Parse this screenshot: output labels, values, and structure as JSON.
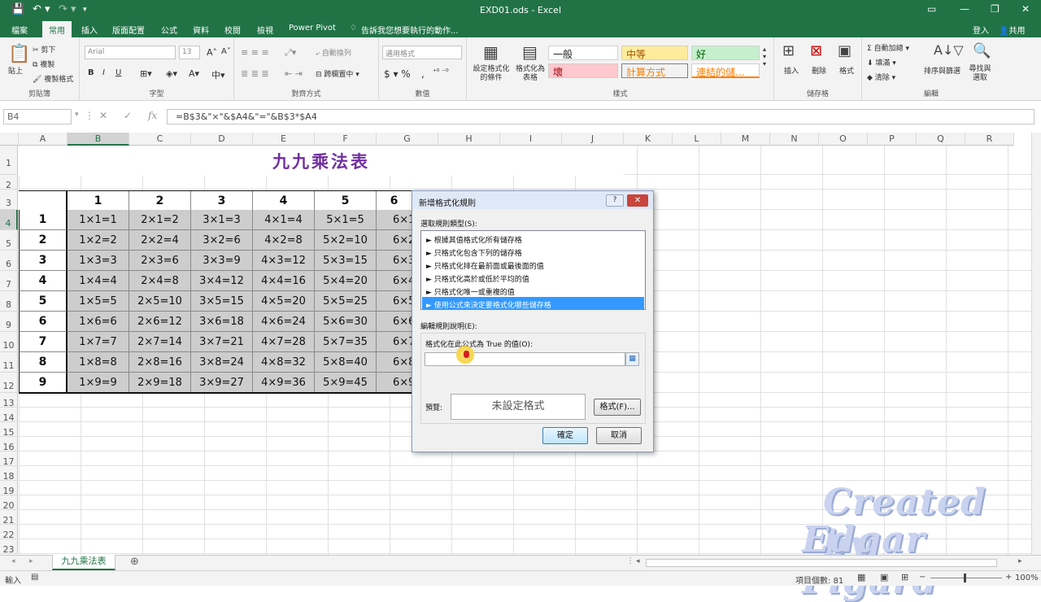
{
  "window": {
    "title": "EXD01.ods - Excel",
    "quick_access": [
      "💾",
      "↶ ▾",
      "↷ ▾",
      "▾"
    ]
  },
  "account": {
    "signin": "登入",
    "share": "共用"
  },
  "tabs": [
    "檔案",
    "常用",
    "插入",
    "版面配置",
    "公式",
    "資料",
    "校閱",
    "檢視",
    "Power Pivot"
  ],
  "tellme": "告訴我您想要執行的動作...",
  "ribbon": {
    "clipboard": {
      "label": "剪貼簿",
      "paste": "貼上",
      "cut": "剪下",
      "copy": "複製",
      "format_painter": "複製格式"
    },
    "font": {
      "label": "字型",
      "font_name": "Arial",
      "font_size": "13",
      "bold": "B",
      "italic": "I",
      "underline": "U"
    },
    "alignment": {
      "label": "對齊方式",
      "wrap": "自動換列",
      "merge": "跨欄置中"
    },
    "number": {
      "label": "數值",
      "format": "通用格式"
    },
    "styles": {
      "label": "樣式",
      "conditional": "設定格式化的條件",
      "table": "格式化為表格",
      "normal": "一般",
      "neutral": "中等",
      "good": "好",
      "bad": "壞",
      "calc": "計算方式",
      "link": "連結的儲..."
    },
    "cells": {
      "label": "儲存格",
      "insert": "插入",
      "delete": "刪除",
      "format": "格式"
    },
    "editing": {
      "label": "編輯",
      "autosum": "自動加總",
      "fill": "填滿",
      "clear": "清除",
      "sort": "排序與篩選",
      "find": "尋找與選取"
    }
  },
  "formula_bar": {
    "cell": "B4",
    "formula": "=B$3&\"×\"&$A4&\"=\"&B$3*$A4",
    "fx": "fx"
  },
  "columns": [
    "A",
    "B",
    "C",
    "D",
    "E",
    "F",
    "G",
    "H",
    "I",
    "J",
    "K",
    "L",
    "M",
    "N",
    "O",
    "P",
    "Q",
    "R"
  ],
  "rows": [
    "1",
    "2",
    "3",
    "4",
    "5",
    "6",
    "7",
    "8",
    "9",
    "10",
    "11",
    "12",
    "13",
    "14",
    "15",
    "16",
    "17",
    "18",
    "19",
    "20",
    "21",
    "22",
    "23"
  ],
  "sheet_title": "九九乘法表",
  "header_row": [
    "1",
    "2",
    "3",
    "4",
    "5",
    "6"
  ],
  "table": [
    {
      "n": "1",
      "cells": [
        "1×1=1",
        "2×1=2",
        "3×1=3",
        "4×1=4",
        "5×1=5",
        "6×1"
      ]
    },
    {
      "n": "2",
      "cells": [
        "1×2=2",
        "2×2=4",
        "3×2=6",
        "4×2=8",
        "5×2=10",
        "6×2="
      ]
    },
    {
      "n": "3",
      "cells": [
        "1×3=3",
        "2×3=6",
        "3×3=9",
        "4×3=12",
        "5×3=15",
        "6×3="
      ]
    },
    {
      "n": "4",
      "cells": [
        "1×4=4",
        "2×4=8",
        "3×4=12",
        "4×4=16",
        "5×4=20",
        "6×4="
      ]
    },
    {
      "n": "5",
      "cells": [
        "1×5=5",
        "2×5=10",
        "3×5=15",
        "4×5=20",
        "5×5=25",
        "6×5="
      ]
    },
    {
      "n": "6",
      "cells": [
        "1×6=6",
        "2×6=12",
        "3×6=18",
        "4×6=24",
        "5×6=30",
        "6×6="
      ]
    },
    {
      "n": "7",
      "cells": [
        "1×7=7",
        "2×7=14",
        "3×7=21",
        "4×7=28",
        "5×7=35",
        "6×7="
      ]
    },
    {
      "n": "8",
      "cells": [
        "1×8=8",
        "2×8=16",
        "3×8=24",
        "4×8=32",
        "5×8=40",
        "6×8="
      ]
    },
    {
      "n": "9",
      "cells": [
        "1×9=9",
        "2×9=18",
        "3×9=27",
        "4×9=36",
        "5×9=45",
        "6×9="
      ]
    }
  ],
  "dialog": {
    "title": "新增格式化規則",
    "help": "?",
    "close": "✕",
    "select_type": "選取規則類型(S):",
    "rule_types": [
      "► 根據其值格式化所有儲存格",
      "► 只格式化包含下列的儲存格",
      "► 只格式化排在最前面或最後面的值",
      "► 只格式化高於或低於平均的值",
      "► 只格式化唯一或重複的值",
      "► 使用公式來決定要格式化哪些儲存格"
    ],
    "edit_desc": "編輯規則說明(E):",
    "formula_label": "格式化在此公式為 True 的值(O):",
    "formula_value": "",
    "preview_label": "預覽:",
    "preview_text": "未設定格式",
    "format_btn": "格式(F)...",
    "ok": "確定",
    "cancel": "取消"
  },
  "sheet_tab": "九九乘法表",
  "status": {
    "mode": "輸入",
    "count": "項目個數: 81",
    "zoom": "100%"
  },
  "watermark": {
    "line1": "Created by",
    "line2": "Edgar Figard"
  }
}
